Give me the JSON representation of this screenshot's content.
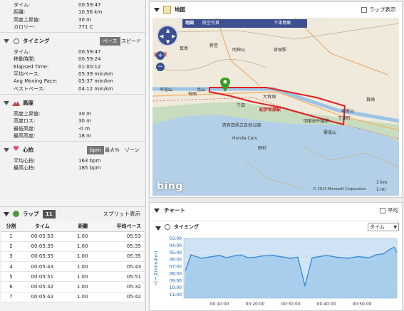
{
  "summary": {
    "rows": [
      {
        "label": "タイム:",
        "value": "00:59:47"
      },
      {
        "label": "距離:",
        "value": "10.56 km"
      },
      {
        "label": "高度上昇値:",
        "value": "30 m"
      },
      {
        "label": "カロリー:",
        "value": "771 C"
      }
    ]
  },
  "timing": {
    "title": "タイミング",
    "tab_pace": "ペース",
    "tab_speed": "スピード",
    "rows": [
      {
        "label": "タイム:",
        "value": "00:59:47"
      },
      {
        "label": "移動時間:",
        "value": "00:59:24"
      },
      {
        "label": "Elapsed Time:",
        "value": "01:00:12"
      },
      {
        "label": "平均ペース:",
        "value": "05:39 min/km"
      },
      {
        "label": "Avg Moving Pace:",
        "value": "05:37 min/km"
      },
      {
        "label": "ベストペース:",
        "value": "04:12 min/km"
      }
    ]
  },
  "elevation": {
    "title": "高度",
    "rows": [
      {
        "label": "高度上昇値:",
        "value": "30 m"
      },
      {
        "label": "高度ロス:",
        "value": "30 m"
      },
      {
        "label": "最低高度:",
        "value": "-0 m"
      },
      {
        "label": "最高高度:",
        "value": "18 m"
      }
    ]
  },
  "heart": {
    "title": "心拍",
    "tab_bpm": "bpm",
    "tab_max": "最大%",
    "tab_zone": "ゾーン",
    "rows": [
      {
        "label": "平均心拍:",
        "value": "163 bpm"
      },
      {
        "label": "最高心拍:",
        "value": "185 bpm"
      }
    ]
  },
  "laps": {
    "title": "ラップ",
    "count": "11",
    "split_link": "スプリット表示",
    "headers": [
      "分割",
      "タイム",
      "距離",
      "平均ペース"
    ],
    "rows": [
      [
        "1",
        "00:05:53",
        "1.00",
        "05:53"
      ],
      [
        "2",
        "00:05:35",
        "1.00",
        "05:35"
      ],
      [
        "3",
        "00:05:35",
        "1.00",
        "05:35"
      ],
      [
        "4",
        "00:05:43",
        "1.00",
        "05:43"
      ],
      [
        "5",
        "00:05:51",
        "1.00",
        "05:51"
      ],
      [
        "6",
        "00:05:32",
        "1.00",
        "05:32"
      ],
      [
        "7",
        "00:05:42",
        "1.00",
        "05:42"
      ]
    ]
  },
  "map": {
    "title": "地図",
    "lap_display": "ラップ表示",
    "map_btn": "地図",
    "photo_btn": "航空写真",
    "bird_btn": "下津鳥瞰",
    "logo": "bing",
    "copyright": "© 2013 Microsoft Corporation",
    "scale_km": "1 km",
    "scale_mi": "1 mi",
    "places": [
      "初島駅",
      "箕島",
      "新堂",
      "明神山",
      "宮原駅",
      "有田",
      "大賀畑",
      "紀伊宮原駅",
      "下津町",
      "岩室山",
      "箕崎",
      "明恵紀州遺跡",
      "千田",
      "北山",
      "平見山",
      "雲雀山",
      "西有田県立自然公園",
      "Honda Cars",
      "田村"
    ],
    "route_colors": {
      "line": "#e02020",
      "marker": "#3a9a2a"
    }
  },
  "chart": {
    "title": "チャート",
    "avg_label": "平均",
    "sub": "タイミング",
    "select": "タイム",
    "ylabel": "ペース(min/km)",
    "series_color": "#3b8fd8",
    "yticks": [
      "03:00",
      "04:00",
      "05:00",
      "06:00",
      "07:00",
      "08:00",
      "09:00",
      "10:00",
      "11:00"
    ],
    "xticks": [
      "00:10:00",
      "00:20:00",
      "00:30:00",
      "00:40:00",
      "00:50:00"
    ]
  },
  "chart_data": {
    "type": "area",
    "xlabel": "",
    "ylabel": "ペース(min/km)",
    "y_reversed": true,
    "ylim": [
      "03:00",
      "11:30"
    ],
    "xlim": [
      "00:00:00",
      "00:59:47"
    ],
    "x": [
      "00:00:30",
      "00:02:00",
      "00:05:00",
      "00:08:00",
      "00:10:00",
      "00:12:00",
      "00:14:00",
      "00:16:00",
      "00:18:00",
      "00:20:00",
      "00:22:00",
      "00:25:00",
      "00:27:00",
      "00:30:00",
      "00:32:00",
      "00:34:00",
      "00:36:00",
      "00:38:00",
      "00:40:00",
      "00:43:00",
      "00:46:00",
      "00:49:00",
      "00:52:00",
      "00:54:00",
      "00:56:00",
      "00:58:00",
      "00:59:00",
      "00:59:47"
    ],
    "y": [
      "07:30",
      "05:20",
      "05:50",
      "05:35",
      "05:25",
      "05:45",
      "05:30",
      "05:20",
      "05:45",
      "05:40",
      "05:30",
      "05:25",
      "05:35",
      "05:50",
      "05:40",
      "09:45",
      "05:45",
      "05:35",
      "05:25",
      "05:40",
      "05:50",
      "05:35",
      "05:45",
      "05:20",
      "05:10",
      "04:30",
      "04:15",
      "05:00"
    ]
  }
}
